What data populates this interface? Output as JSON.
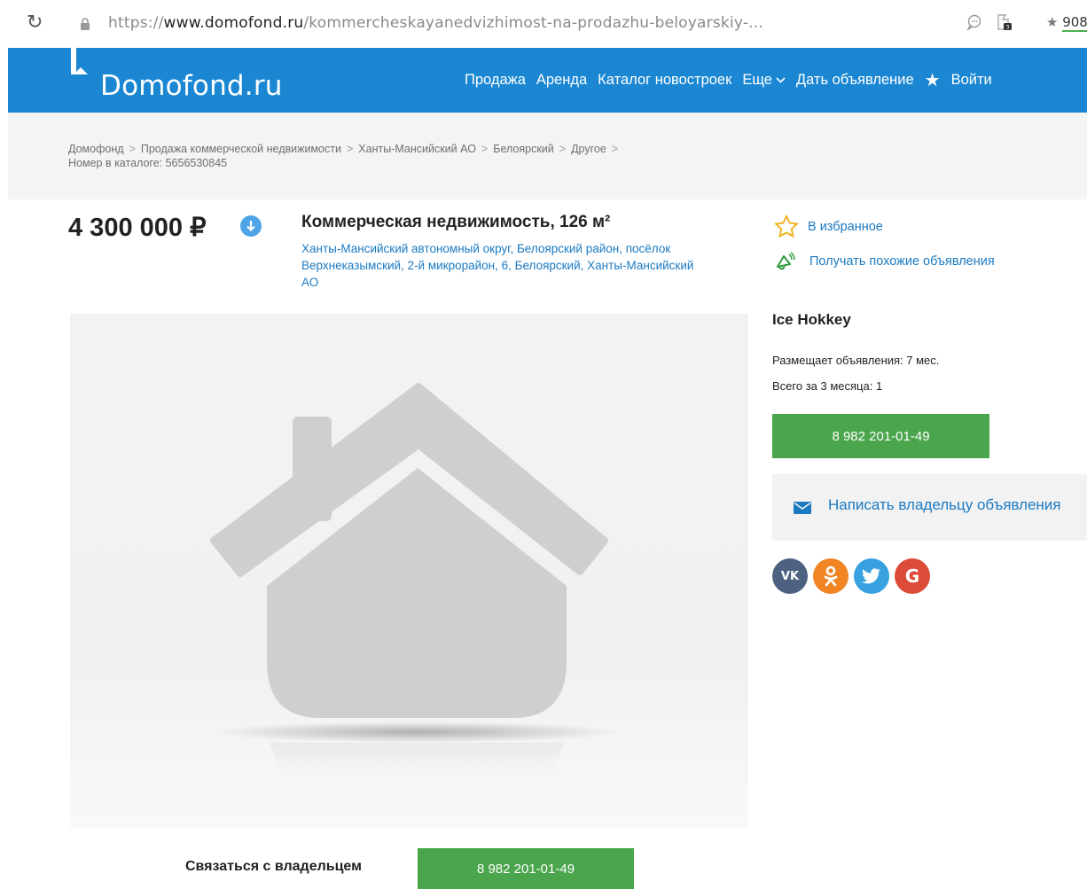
{
  "browser": {
    "url_prefix": "https://",
    "url_domain": "www.domofond.ru",
    "url_path": "/kommercheskayanedvizhimost-na-prodazhu-beloyarskiy-...",
    "extension_count": "908"
  },
  "header": {
    "logo": "Domofond.ru",
    "nav": {
      "sale": "Продажа",
      "rent": "Аренда",
      "catalog": "Каталог новостроек",
      "more": "Еще",
      "post_ad": "Дать объявление",
      "login": "Войти"
    }
  },
  "breadcrumbs": {
    "items": [
      "Домофонд",
      "Продажа коммерческой недвижимости",
      "Ханты-Мансийский АО",
      "Белоярский",
      "Другое"
    ],
    "separator": ">",
    "catalog_number": "Номер в каталоге: 5656530845"
  },
  "listing": {
    "price": "4 300 000 ₽",
    "title": "Коммерческая недвижимость, 126 м²",
    "address": "Ханты-Мансийский автономный округ, Белоярский район, посёлок Верхнеказымский, 2-й микрорайон, 6, Белоярский, Ханты-Мансийский АО"
  },
  "sidebar": {
    "favorite": "В избранное",
    "similar": "Получать похожие объявления",
    "seller_name": "Ice Hokkey",
    "posting_since": "Размещает объявления: 7 мес.",
    "total_3_months": "Всего за 3 месяца: 1",
    "phone": "8 982 201-01-49",
    "write_owner": "Написать владельцу объявления"
  },
  "bottom": {
    "contact_label": "Связаться с владельцем",
    "phone": "8 982 201-01-49"
  },
  "social": {
    "vk": "VK",
    "gp": "G"
  },
  "colors": {
    "brand_blue": "#1b87d3",
    "link_blue": "#1b7ac2",
    "green": "#4aa54c"
  }
}
